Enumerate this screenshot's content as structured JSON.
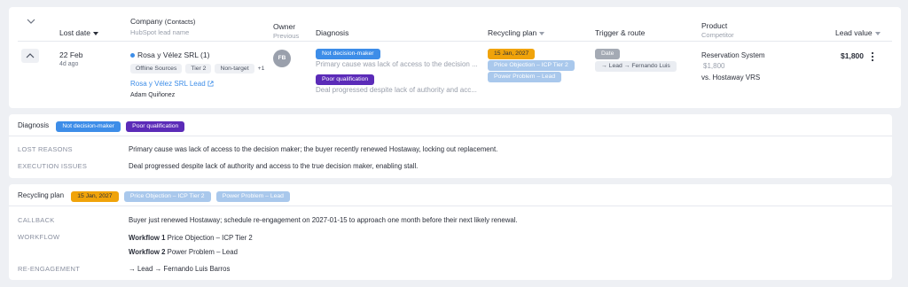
{
  "header": {
    "lost_date": "Lost date",
    "company": "Company",
    "company_sub": "(Contacts)",
    "company_hint": "HubSpot lead name",
    "owner": "Owner",
    "owner_sub": "Previous",
    "diagnosis": "Diagnosis",
    "recycling_plan": "Recycling plan",
    "trigger_route": "Trigger & route",
    "product": "Product",
    "product_sub": "Competitor",
    "lead_value": "Lead value"
  },
  "row": {
    "date": "22 Feb",
    "ago": "4d ago",
    "company_name": "Rosa y Vélez SRL",
    "contacts_count": "(1)",
    "tags": [
      "Offline Sources",
      "Tier 2",
      "Non-target"
    ],
    "more_tags": "+1",
    "lead_link": "Rosa y Vélez SRL Lead",
    "contact_person": "Adam Quiñonez",
    "owner_initials": "FB",
    "diag_badge_1": "Not decision-maker",
    "diag_text_1": "Primary cause was lack of access to the decision ...",
    "diag_badge_2": "Poor qualification",
    "diag_text_2": "Deal progressed despite lack of authority and acc...",
    "plan_date": "15 Jan, 2027",
    "plan_tag_1": "Price Objection – ICP Tier 2",
    "plan_tag_2": "Power Problem – Lead",
    "trigger_badge": "Date",
    "trigger_route": "→ Lead → Fernando Luis",
    "product_name": "Reservation System",
    "product_value": "$1,800",
    "competitor": "vs. Hostaway VRS",
    "lead_value": "$1,800"
  },
  "diagnosis_panel": {
    "title": "Diagnosis",
    "badge_1": "Not decision-maker",
    "badge_2": "Poor qualification",
    "lost_reasons_label": "LOST REASONS",
    "lost_reasons": "Primary cause was lack of access to the decision maker; the buyer recently renewed Hostaway, locking out replacement.",
    "execution_label": "EXECUTION ISSUES",
    "execution": "Deal progressed despite lack of authority and access to the true decision maker, enabling stall."
  },
  "recycling_panel": {
    "title": "Recycling plan",
    "date": "15 Jan, 2027",
    "tag_1": "Price Objection – ICP Tier 2",
    "tag_2": "Power Problem – Lead",
    "callback_label": "CALLBACK",
    "callback": "Buyer just renewed Hostaway; schedule re-engagement on 2027-01-15 to approach one month before their next likely renewal.",
    "workflow_label": "WORKFLOW",
    "workflow_1_num": "Workflow 1",
    "workflow_1": "Price Objection – ICP Tier 2",
    "workflow_2_num": "Workflow 2",
    "workflow_2": "Power Problem – Lead",
    "reengage_label": "RE-ENGAGEMENT",
    "reengage": "→ Lead → Fernando Luis Barros"
  },
  "colors": {
    "accent_blue": "#3d8de8",
    "accent_purple": "#5b2bb8",
    "accent_orange": "#f0a30a",
    "light_blue": "#a9c8ec"
  }
}
